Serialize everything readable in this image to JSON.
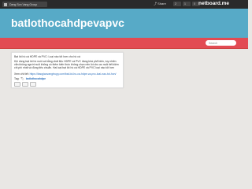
{
  "topbar": {
    "menu_label": "Dang Son Vang Group",
    "share_label": "Share",
    "counters": [
      "2",
      "1",
      "0"
    ],
    "brand": "netboard.me"
  },
  "header": {
    "title": "batlothocahdpevapvc"
  },
  "search": {
    "placeholder": "Search"
  },
  "post": {
    "line1": "Bạt lót hồ cá HDPE và PVC: Loại nào tốt hơn cho hồ cá",
    "paragraph": "Khi dùng bạt lót hồ nuôi cá bằng chất liệu HDPE và PVC đang khá phổ biến, tuy nhiên vẫn không người nuôi không có thêm kiến thức không chọn nên lót cho ao nuôi tiết kiệm chi phí nhất và đúng tiêu chuẩn. Hai loại bạt lót hồ cá HDPE và PVC loại nào tốt hơn",
    "more_prefix": "Xem chi tiết:",
    "more_link": "https://bacgiaovangtruyg.com/bat-lot-ho-ca-hdpe-va-pvc-loai-nao-tot-hon/",
    "tag_label": "Tag:",
    "tag_name": "batlothocahdpe"
  }
}
